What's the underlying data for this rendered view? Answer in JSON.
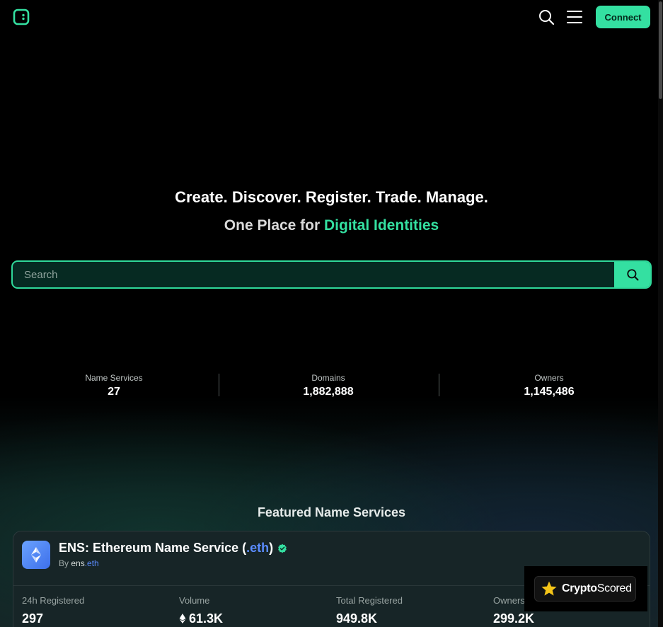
{
  "header": {
    "connect_label": "Connect"
  },
  "hero": {
    "tagline_words": [
      "Create.",
      "Discover.",
      "Register.",
      "Trade.",
      "Manage."
    ],
    "subtitle_prefix": "One Place for ",
    "subtitle_accent": "Digital Identities"
  },
  "search": {
    "placeholder": "Search",
    "value": ""
  },
  "stats": [
    {
      "label": "Name Services",
      "value": "27"
    },
    {
      "label": "Domains",
      "value": "1,882,888"
    },
    {
      "label": "Owners",
      "value": "1,145,486"
    }
  ],
  "featured": {
    "title": "Featured Name Services",
    "card": {
      "name": "ENS: Ethereum Name Service (",
      "tld": ".eth",
      "name_close": ")",
      "by_prefix": "By ",
      "owner_name": "ens",
      "owner_tld": ".eth",
      "metrics": [
        {
          "label": "24h Registered",
          "value": "297"
        },
        {
          "label": "Volume",
          "value": "61.3K"
        },
        {
          "label": "Total Registered",
          "value": "949.8K"
        },
        {
          "label": "Owners",
          "value": "299.2K"
        }
      ]
    }
  },
  "badge": {
    "brand_bold": "Crypto",
    "brand_light": "Scored"
  },
  "colors": {
    "accent": "#34e0a1",
    "tld_blue": "#5b8cff",
    "card_bg": "#172527"
  },
  "icons": [
    "logo-icon",
    "search-icon",
    "menu-icon",
    "ens-logo-icon",
    "verified-icon",
    "eth-icon",
    "star-icon"
  ]
}
